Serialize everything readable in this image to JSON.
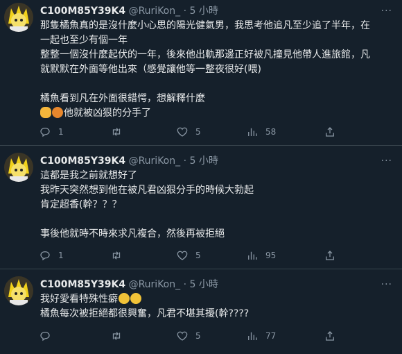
{
  "tweets": [
    {
      "name": "C100M85Y39K4",
      "handle": "@RuriKon_",
      "sep": "·",
      "time": "5 小時",
      "lines": [
        "那隻橘魚真的是沒什麼小心思的陽光健氣男，我思考他追凡至少追了半年，在",
        "一起也至少有個一年",
        "整整一個沒什麼起伏的一年，後來他出軌那邊正好被凡撞見他帶人進旅館，凡",
        "就默默在外面等他出來（感覺讓他等一整夜很好(喂)",
        "",
        "橘魚看到凡在外面很錯愕，想解釋什麼",
        "他就被凶狠的分手了"
      ],
      "emoji_line": "他就被凶狠的分手了",
      "emoji_names": [
        "punch-emoji",
        "angry-emoji"
      ],
      "reply_count": "1",
      "retweet_count": "",
      "like_count": "5",
      "view_count": "58"
    },
    {
      "name": "C100M85Y39K4",
      "handle": "@RuriKon_",
      "sep": "·",
      "time": "5 小時",
      "lines": [
        "這都是我之前就想好了",
        "我昨天突然想到他在被凡君凶狠分手的時候大勃起",
        "肯定超香(幹？？？",
        "",
        "事後他就時不時來求凡複合，然後再被拒絕"
      ],
      "reply_count": "1",
      "retweet_count": "",
      "like_count": "5",
      "view_count": "95"
    },
    {
      "name": "C100M85Y39K4",
      "handle": "@RuriKon_",
      "sep": "·",
      "time": "5 小時",
      "lines": [
        "我好愛看特殊性癖",
        "橘魚每次被拒絕都很興奮，凡君不堪其擾(幹????"
      ],
      "emoji_names_line1": [
        "woozy-emoji",
        "woozy-emoji"
      ],
      "reply_count": "",
      "retweet_count": "",
      "like_count": "5",
      "view_count": "77"
    }
  ],
  "icons": {
    "reply": "reply-icon",
    "retweet": "retweet-icon",
    "like": "heart-icon",
    "views": "views-icon",
    "share": "share-icon",
    "more": "more-icon"
  },
  "colors": {
    "background": "#15202b",
    "text": "#e7e9ea",
    "muted": "#8b98a5",
    "divider": "#38444d"
  }
}
